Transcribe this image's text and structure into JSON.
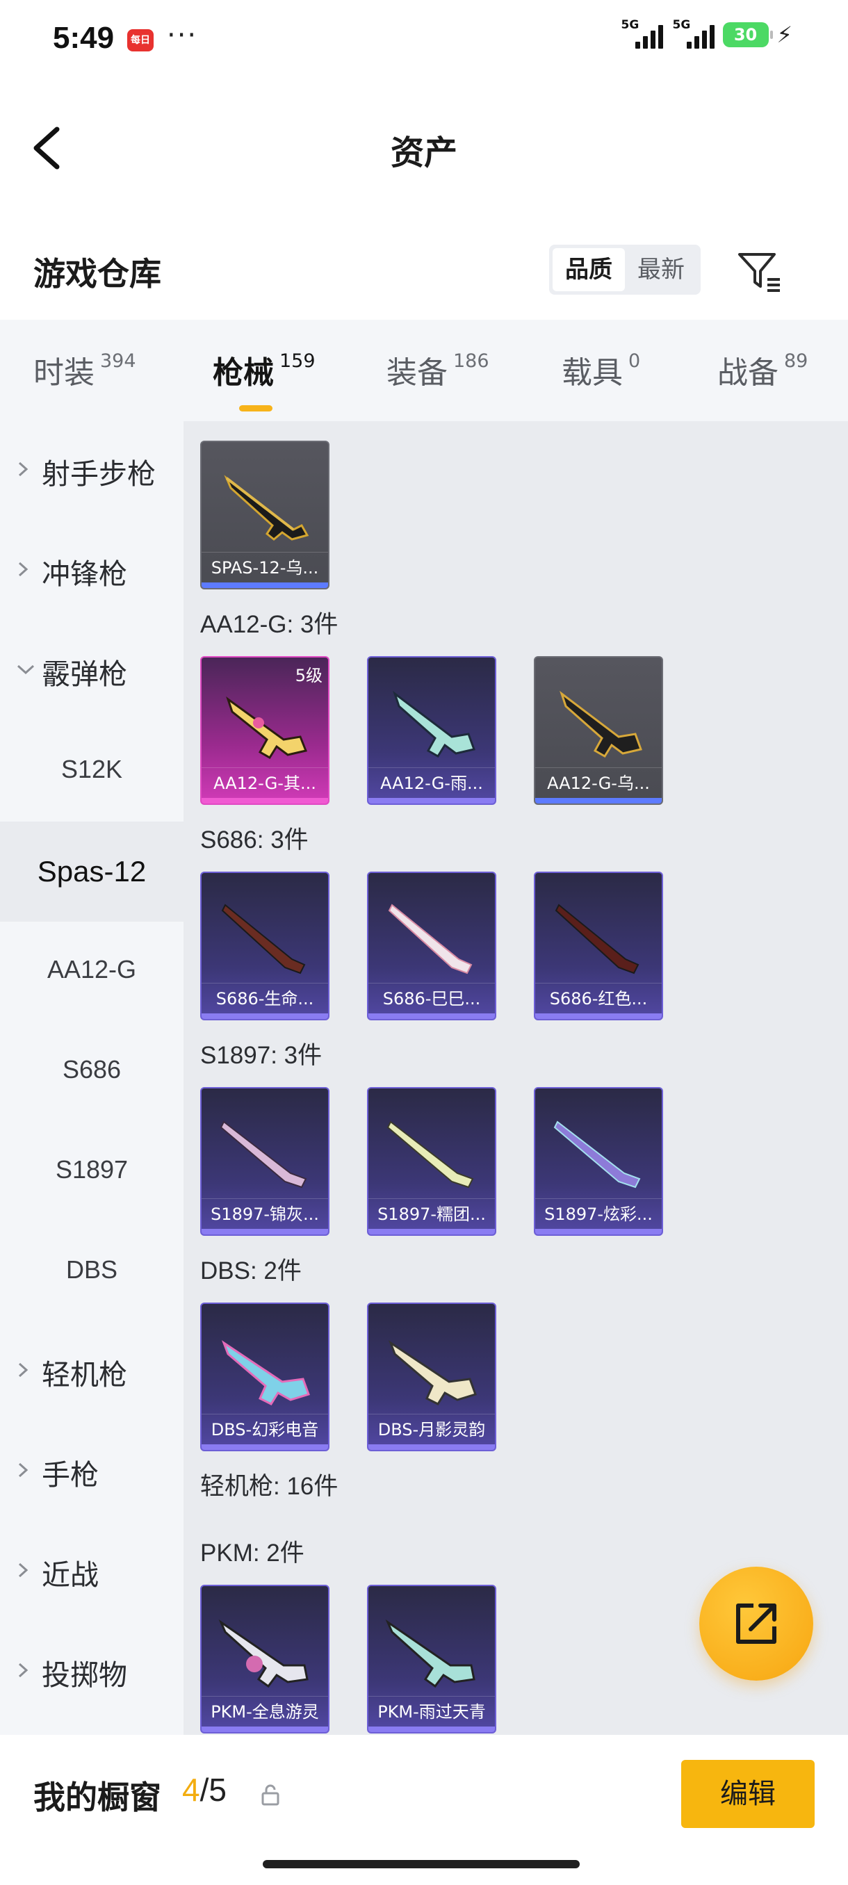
{
  "status": {
    "time": "5:49",
    "app_badge": "每日",
    "dots": "···",
    "net1": "5G",
    "net2": "5G",
    "battery": "30",
    "bolt": "⚡"
  },
  "nav": {
    "title": "资产"
  },
  "warehouse": {
    "title": "游戏仓库",
    "sort_quality": "品质",
    "sort_newest": "最新"
  },
  "tabs": [
    {
      "label": "时装",
      "count": "394"
    },
    {
      "label": "枪械",
      "count": "159"
    },
    {
      "label": "装备",
      "count": "186"
    },
    {
      "label": "载具",
      "count": "0"
    },
    {
      "label": "战备",
      "count": "89"
    }
  ],
  "sidebar": {
    "marksman": "射手步枪",
    "smg": "冲锋枪",
    "shotgun": "霰弹枪",
    "s12k": "S12K",
    "spas12": "Spas-12",
    "aa12g": "AA12-G",
    "s686": "S686",
    "s1897": "S1897",
    "dbs": "DBS",
    "lmg": "轻机枪",
    "pistol": "手枪",
    "melee": "近战",
    "throwable": "投掷物"
  },
  "groups": {
    "aa12g": "AA12-G: 3件",
    "s686": "S686: 3件",
    "s1897": "S1897: 3件",
    "dbs": "DBS: 2件",
    "lmg": "轻机枪: 16件",
    "pkm": "PKM: 2件"
  },
  "cards": {
    "spas": "SPAS-12-乌...",
    "aa1": "AA12-G-其...",
    "aa1_level": "5级",
    "aa2": "AA12-G-雨...",
    "aa3": "AA12-G-乌...",
    "s6861": "S686-生命...",
    "s6862": "S686-巳巳...",
    "s6863": "S686-红色...",
    "s18971": "S1897-锦灰...",
    "s18972": "S1897-糯团...",
    "s18973": "S1897-炫彩...",
    "dbs1": "DBS-幻彩电音",
    "dbs2": "DBS-月影灵韵",
    "pkm1": "PKM-全息游灵",
    "pkm2": "PKM-雨过天青"
  },
  "showcase": {
    "label": "我的橱窗",
    "current": "4",
    "total": "/5",
    "edit": "编辑"
  },
  "colors": {
    "accent": "#f7b31a",
    "purple_card": "#3c3776",
    "gray_card": "#4a4b52",
    "pink_card": "#9a2a8e"
  }
}
